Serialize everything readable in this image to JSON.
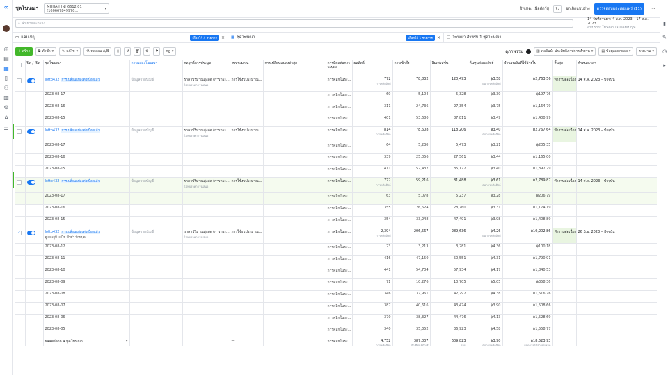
{
  "topbar": {
    "title": "ชุดโฆษณา",
    "account": "MHHA-HINH6612 01 (160667849970...",
    "owner_label": "อิทเทค: เนื้อสัตว์ทุ",
    "discard_label": "ยกเลิกแบบร่าง",
    "review_button": "ตรวจสอบและเผยแพร่ (11)",
    "more": "···"
  },
  "search": {
    "placeholder": "ค้นหาและกรอง",
    "date_range": "14 วันที่ผ่านมา: 4 ส.ค. 2023 – 17 ส.ค. 2023",
    "date_sub": "ฉบับร่าง: โฆษณาและแคมเปญที่"
  },
  "panes": {
    "campaigns": "แคมเปญ",
    "campaigns_chip": "เลือกไว้ 4 รายการ",
    "adsets": "ชุดโฆษณา",
    "adsets_chip": "เลือกไว้ 1 รายการ",
    "ads": "โฆษณา สำหรับ 1 ชุดโฆษณา"
  },
  "toolbar": {
    "create": "+ สร้าง",
    "duplicate": "ทำซ้ำ",
    "edit": "แก้ไข",
    "ab_test": "ทดสอบ A/B",
    "rules": "กฎ",
    "overview": "ดูภาพรวม",
    "columns": "คอลัมน์: ประสิทธิภาพการทำงาน",
    "breakdown": "ข้อมูลแยกย่อย",
    "reports": "รายงาน"
  },
  "columns": [
    "ปิด / เปิด",
    "ชุดโฆษณา",
    "การแสดงโฆษณา",
    "กลยุทธ์การประมูล",
    "งบประมาณ",
    "การเปลี่ยนแปลงล่าสุด",
    "การมีผลต่อการระบุผล",
    "ผลลัพธ์",
    "การเข้าถึง",
    "อิมเพรสชั่น",
    "ต้นทุนต่อผลลัพธ์",
    "จำนวนเงินที่ใช้จ่ายไป",
    "สิ้นสุด",
    "กำหนดเวลา"
  ],
  "common": {
    "source": "ข้อมูลจากบัญชี",
    "bid_strategy": "ราคาปริมาณสูงสุด (การกระ...",
    "bid_sub": "ไม่พบราคาการเสนอ",
    "budget": "การใช้งบประมาณ...",
    "attribution": "การคลิกในระ...",
    "results_sub": "การคลิกลิงก์",
    "cost_sub": "ต่อการคลิกลิงก์",
    "delivery": "ทำงานต่อเนื่อง...",
    "tag": "การเปลี่ยนแปลงต่อเนื่องแล้ว"
  },
  "rows": [
    {
      "type": "camp",
      "name": "lotto432",
      "results": "772",
      "reach": "78,832",
      "impr": "120,493",
      "cost": "฿3.58",
      "spent": "฿2,763.56",
      "schedule": "14 ส.ค. 2023 – ปัจจุบัน"
    },
    {
      "type": "sub",
      "date": "2023-08-17",
      "results": "60",
      "reach": "5,104",
      "impr": "5,328",
      "cost": "฿3.30",
      "spent": "฿197.76"
    },
    {
      "type": "sub",
      "date": "2023-08-16",
      "results": "311",
      "reach": "24,736",
      "impr": "27,354",
      "cost": "฿3.75",
      "spent": "฿1,164.79"
    },
    {
      "type": "sub",
      "date": "2023-08-15",
      "results": "401",
      "reach": "53,680",
      "impr": "87,811",
      "cost": "฿3.49",
      "spent": "฿1,400.99"
    },
    {
      "type": "camp",
      "name": "lotto432",
      "results": "814",
      "reach": "78,608",
      "impr": "118,206",
      "cost": "฿3.40",
      "spent": "฿2,767.64",
      "schedule": "14 ส.ค. 2023 – ปัจจุบัน"
    },
    {
      "type": "sub",
      "date": "2023-08-17",
      "results": "64",
      "reach": "5,230",
      "impr": "5,473",
      "cost": "฿3.21",
      "spent": "฿205.35"
    },
    {
      "type": "sub",
      "date": "2023-08-16",
      "results": "339",
      "reach": "25,056",
      "impr": "27,561",
      "cost": "฿3.44",
      "spent": "฿1,165.00"
    },
    {
      "type": "sub",
      "date": "2023-08-15",
      "results": "411",
      "reach": "52,432",
      "impr": "85,172",
      "cost": "฿3.40",
      "spent": "฿1,397.29"
    },
    {
      "type": "camp",
      "name": "lotto432",
      "results": "772",
      "reach": "59,216",
      "impr": "81,488",
      "cost": "฿3.61",
      "spent": "฿2,789.87",
      "schedule": "14 ส.ค. 2023 – ปัจจุบัน",
      "hl": true
    },
    {
      "type": "sub",
      "date": "2023-08-17",
      "results": "63",
      "reach": "5,078",
      "impr": "5,237",
      "cost": "฿3.28",
      "spent": "฿206.79",
      "hl": true
    },
    {
      "type": "sub",
      "date": "2023-08-16",
      "results": "355",
      "reach": "26,624",
      "impr": "28,760",
      "cost": "฿3.31",
      "spent": "฿1,174.19"
    },
    {
      "type": "sub",
      "date": "2023-08-15",
      "results": "354",
      "reach": "33,248",
      "impr": "47,491",
      "cost": "฿3.98",
      "spent": "฿1,408.89"
    },
    {
      "type": "camp",
      "name": "lotto432",
      "results": "2,394",
      "reach": "206,567",
      "impr": "289,636",
      "cost": "฿4.26",
      "spent": "฿10,202.86",
      "schedule": "26 มิ.ย. 2023 – ปัจจุบัน",
      "checked": true,
      "actions": "ดูแผนภูมิ  แก้ไข  ทำซ้ำ  ปักหมุด"
    },
    {
      "type": "sub",
      "date": "2023-08-12",
      "results": "23",
      "reach": "3,213",
      "impr": "3,281",
      "cost": "฿4.36",
      "spent": "฿100.18"
    },
    {
      "type": "sub",
      "date": "2023-08-11",
      "results": "416",
      "reach": "47,150",
      "impr": "50,551",
      "cost": "฿4.31",
      "spent": "฿1,790.91"
    },
    {
      "type": "sub",
      "date": "2023-08-10",
      "results": "441",
      "reach": "54,704",
      "impr": "57,934",
      "cost": "฿4.17",
      "spent": "฿1,840.53"
    },
    {
      "type": "sub",
      "date": "2023-08-09",
      "results": "71",
      "reach": "10,276",
      "impr": "10,705",
      "cost": "฿5.05",
      "spent": "฿358.36"
    },
    {
      "type": "sub",
      "date": "2023-08-08",
      "results": "346",
      "reach": "37,961",
      "impr": "42,292",
      "cost": "฿4.38",
      "spent": "฿1,516.76"
    },
    {
      "type": "sub",
      "date": "2023-08-07",
      "results": "387",
      "reach": "40,616",
      "impr": "43,474",
      "cost": "฿3.90",
      "spent": "฿1,508.66"
    },
    {
      "type": "sub",
      "date": "2023-08-06",
      "results": "370",
      "reach": "38,327",
      "impr": "44,476",
      "cost": "฿4.13",
      "spent": "฿1,528.69"
    },
    {
      "type": "sub",
      "date": "2023-08-05",
      "results": "340",
      "reach": "35,352",
      "impr": "36,923",
      "cost": "฿4.58",
      "spent": "฿1,558.77"
    }
  ],
  "total": {
    "label": "ผลลัพธ์จาก 4 ชุดโฆษณา",
    "budget": "—",
    "attribution": "การคลิกในระ...",
    "results": "4,752",
    "results_sub": "การคลิกลิงก์",
    "reach": "387,007",
    "reach_sub": "บัญชีศูนย์บัญชี",
    "impr": "609,823",
    "impr_sub": "รวม",
    "cost": "฿3.90",
    "cost_sub": "ต่อการคลิกลิงก์",
    "spent": "฿18,523.93",
    "spent_sub": "ยอดการใช้จ่ายทั้งหมด"
  }
}
